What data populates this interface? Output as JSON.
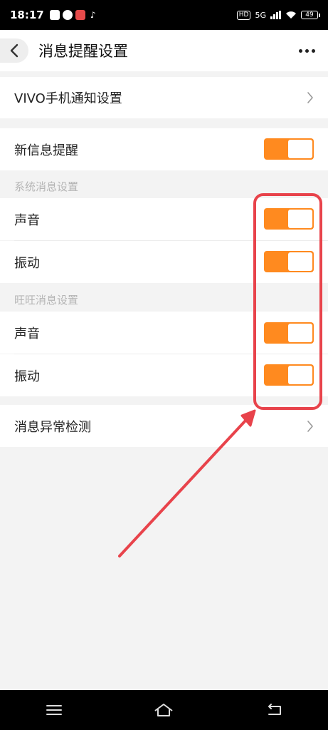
{
  "status_bar": {
    "time": "18:17",
    "network": "5G",
    "hd": "HD",
    "battery": "49"
  },
  "header": {
    "title": "消息提醒设置"
  },
  "rows": {
    "vivo_notify": "VIVO手机通知设置",
    "new_message": "新信息提醒",
    "system_section": "系统消息设置",
    "system_sound": "声音",
    "system_vibrate": "振动",
    "wangwang_section": "旺旺消息设置",
    "wangwang_sound": "声音",
    "wangwang_vibrate": "振动",
    "message_exception": "消息异常检测"
  },
  "toggles": {
    "new_message": true,
    "system_sound": true,
    "system_vibrate": true,
    "wangwang_sound": true,
    "wangwang_vibrate": true
  },
  "colors": {
    "accent": "#ff8a1f",
    "annotation": "#e8434b",
    "background": "#f3f3f3"
  },
  "icons": {
    "back": "chevron-left-icon",
    "more": "more-dots-icon",
    "chevron": "chevron-right-icon",
    "nav_menu": "menu-icon",
    "nav_home": "home-icon",
    "nav_back": "back-icon"
  }
}
